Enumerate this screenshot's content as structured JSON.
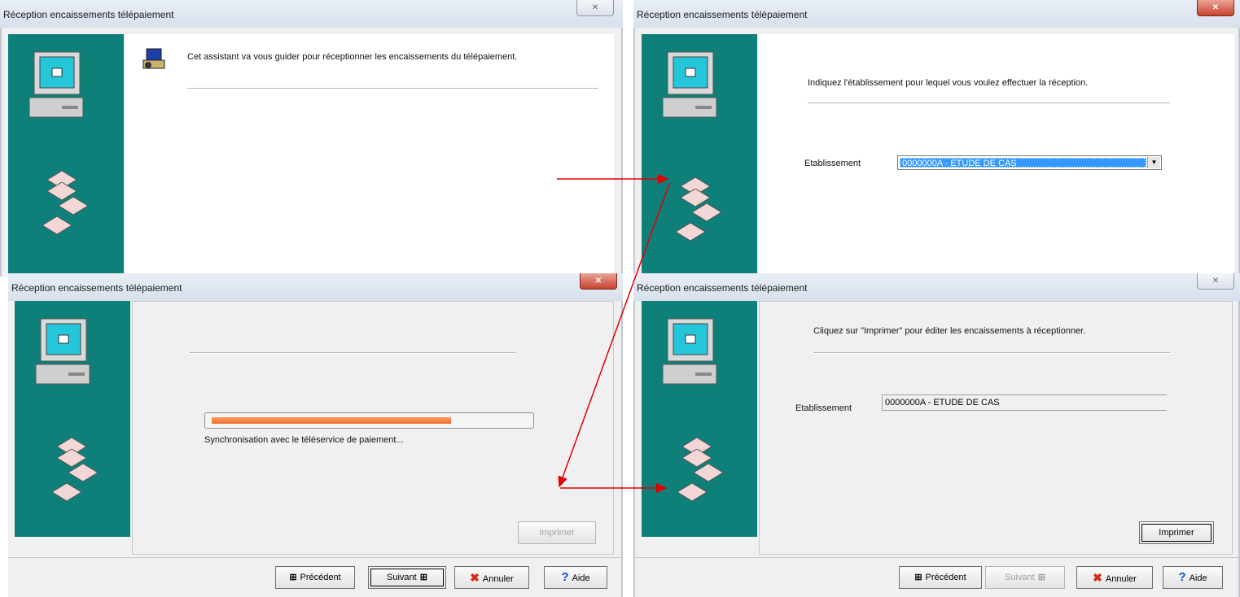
{
  "windows": [
    {
      "title": "Réception encaissements télépaiement",
      "close_label": "✕",
      "intro_text": "Cet assistant va vous guider pour réceptionner les encaissements du télépaiement."
    },
    {
      "title": "Réception encaissements télépaiement",
      "close_label": "✕",
      "instruction": "Indiquez l'établissement pour lequel vous voulez effectuer la réception.",
      "field_label": "Etablissement",
      "field_value": "0000000A - ETUDE DE CAS"
    },
    {
      "title": "Réception encaissements télépaiement",
      "close_label": "✕",
      "progress_percent": 76,
      "progress_text": "Synchronisation avec le téléservice de paiement...",
      "print_label": "Imprimer",
      "buttons": {
        "prev": "Précédent",
        "next": "Suivant",
        "cancel": "Annuler",
        "help": "Aide"
      }
    },
    {
      "title": "Réception encaissements télépaiement",
      "close_label": "✕",
      "instruction": "Cliquez sur \"Imprimer\" pour éditer les encaissements à réceptionner.",
      "field_label": "Etablissement",
      "field_value": "0000000A - ETUDE DE CAS",
      "print_label": "Imprimer",
      "buttons": {
        "prev": "Précédent",
        "next": "Suivant",
        "cancel": "Annuler",
        "help": "Aide"
      }
    }
  ],
  "colors": {
    "sidebar": "#0f7f7a",
    "arrows": "#e00000",
    "progress": "#f07030"
  }
}
